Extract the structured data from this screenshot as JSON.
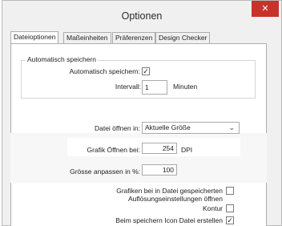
{
  "dialog": {
    "title": "Optionen",
    "close_symbol": "✕"
  },
  "tabs": [
    {
      "label": "Dateioptionen",
      "active": true
    },
    {
      "label": "Maßeinheiten",
      "active": false
    },
    {
      "label": "Präferenzen",
      "active": false
    },
    {
      "label": "Design Checker",
      "active": false
    }
  ],
  "autosave": {
    "group_title": "Automatisch speichern",
    "enable_label": "Automatisch speichern:",
    "enable_checked": "✓",
    "interval_label": "Intervall:",
    "interval_value": "1",
    "interval_unit": "Minuten"
  },
  "open_file": {
    "label": "Datei öffnen in:",
    "value": "Aktuelle Größe",
    "chevron": "⌄"
  },
  "graphic_open": {
    "label": "Grafik Öffnen bei:",
    "value": "254",
    "unit": "DPI"
  },
  "resize": {
    "label": "Grösse anpassen in %:",
    "value": "100"
  },
  "save_graphics": {
    "line1": "Grafiken bei in Datei gespeicherten",
    "line2": "Auflösungseinstellungen öffnen"
  },
  "outline": {
    "label": "Kontur"
  },
  "save_icon": {
    "label": "Beim speichern Icon Datei erstellen",
    "checked": "✓"
  }
}
